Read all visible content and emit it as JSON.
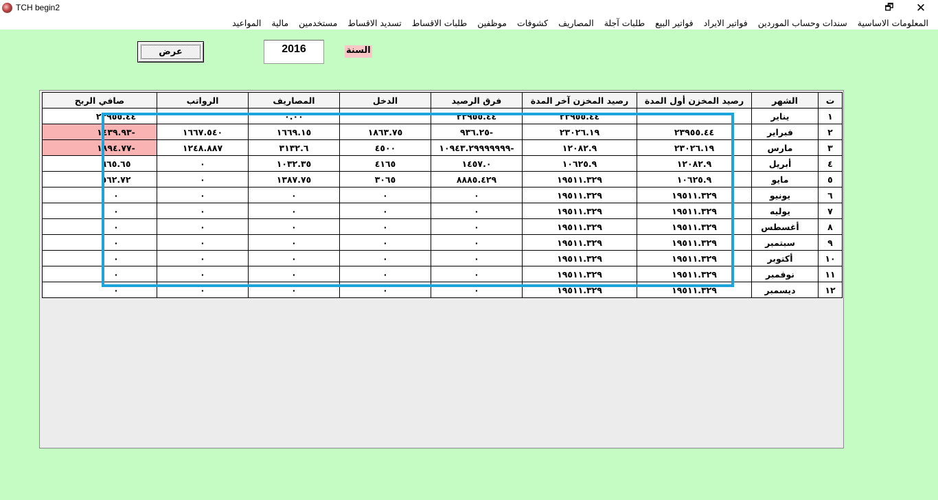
{
  "window": {
    "title": "TCH begin2",
    "restore_glyph": "🗗",
    "close_glyph": "✕"
  },
  "menu": [
    "المعلومات الاساسية",
    "سندات وحساب الموردين",
    "فواتير الايراد",
    "فواتير البيع",
    "طلبات آجلة",
    "المصاريف",
    "كشوفات",
    "موظفين",
    "طلبات الاقساط",
    "تسديد الاقساط",
    "مستخدمين",
    "مالية",
    "المواعيد"
  ],
  "form": {
    "show_button": "عرض",
    "year_value": "2016",
    "year_label": "السنة"
  },
  "table": {
    "headers": {
      "idx": "ت",
      "month": "الشهر",
      "stock_start": "رصيد المخزن أول المدة",
      "stock_end": "رصيد المخزن آخر المدة",
      "balance_diff": "فرق الرصيد",
      "income": "الدخل",
      "expenses": "المصاريف",
      "salaries": "الرواتب",
      "net_profit": "صافي الربح"
    },
    "rows": [
      {
        "idx": "١",
        "month": "يناير",
        "stock_start": "",
        "stock_end": "٢٣٩٥٥.٤٤",
        "balance_diff": "٢٣٩٥٥.٤٤",
        "income": "",
        "expenses": "٠.٠٠",
        "salaries": "",
        "net_profit": "٢٣٩٥٥.٤٤",
        "negative": false
      },
      {
        "idx": "٢",
        "month": "فبراير",
        "stock_start": "٢٣٩٥٥.٤٤",
        "stock_end": "٢٣٠٢٦.١٩",
        "balance_diff": "٩٣٦.٢٥-",
        "income": "١٨٦٣.٧٥",
        "expenses": "١٦٦٩.١٥",
        "salaries": "١٦٦٧.٥٤٠",
        "net_profit": "١٤٣٩.٩٣-",
        "negative": true
      },
      {
        "idx": "٣",
        "month": "مارس",
        "stock_start": "٢٣٠٢٦.١٩",
        "stock_end": "١٢٠٨٢.٩",
        "balance_diff": "١٠٩٤٣.٢٩٩٩٩٩٩٩-",
        "income": "٤٥٠٠",
        "expenses": "٣١٣٢.٦",
        "salaries": "١٢٤٨.٨٨٧",
        "net_profit": "١٨٩٤.٧٧-",
        "negative": true
      },
      {
        "idx": "٤",
        "month": "أبريل",
        "stock_start": "١٢٠٨٢.٩",
        "stock_end": "١٠٦٢٥.٩",
        "balance_diff": "١٤٥٧.٠",
        "income": "٤١٦٥",
        "expenses": "١٠٣٢.٣٥",
        "salaries": "٠",
        "net_profit": "٦٦٥.٦٥",
        "negative": false
      },
      {
        "idx": "٥",
        "month": "مايو",
        "stock_start": "١٠٦٢٥.٩",
        "stock_end": "١٩٥١١.٣٢٩",
        "balance_diff": "٨٨٨٥.٤٢٩",
        "income": "٣٠٦٥",
        "expenses": "١٣٨٧.٧٥",
        "salaries": "٠",
        "net_profit": "٥٦٢.٧٢",
        "negative": false
      },
      {
        "idx": "٦",
        "month": "يونيو",
        "stock_start": "١٩٥١١.٣٢٩",
        "stock_end": "١٩٥١١.٣٢٩",
        "balance_diff": "٠",
        "income": "٠",
        "expenses": "٠",
        "salaries": "٠",
        "net_profit": "٠",
        "negative": false
      },
      {
        "idx": "٧",
        "month": "يوليه",
        "stock_start": "١٩٥١١.٣٢٩",
        "stock_end": "١٩٥١١.٣٢٩",
        "balance_diff": "٠",
        "income": "٠",
        "expenses": "٠",
        "salaries": "٠",
        "net_profit": "٠",
        "negative": false
      },
      {
        "idx": "٨",
        "month": "أغسطس",
        "stock_start": "١٩٥١١.٣٢٩",
        "stock_end": "١٩٥١١.٣٢٩",
        "balance_diff": "٠",
        "income": "٠",
        "expenses": "٠",
        "salaries": "٠",
        "net_profit": "٠",
        "negative": false
      },
      {
        "idx": "٩",
        "month": "سبتمبر",
        "stock_start": "١٩٥١١.٣٢٩",
        "stock_end": "١٩٥١١.٣٢٩",
        "balance_diff": "٠",
        "income": "٠",
        "expenses": "٠",
        "salaries": "٠",
        "net_profit": "٠",
        "negative": false
      },
      {
        "idx": "١٠",
        "month": "أكتوبر",
        "stock_start": "١٩٥١١.٣٢٩",
        "stock_end": "١٩٥١١.٣٢٩",
        "balance_diff": "٠",
        "income": "٠",
        "expenses": "٠",
        "salaries": "٠",
        "net_profit": "٠",
        "negative": false
      },
      {
        "idx": "١١",
        "month": "نوفمبر",
        "stock_start": "١٩٥١١.٣٢٩",
        "stock_end": "١٩٥١١.٣٢٩",
        "balance_diff": "٠",
        "income": "٠",
        "expenses": "٠",
        "salaries": "٠",
        "net_profit": "٠",
        "negative": false
      },
      {
        "idx": "١٢",
        "month": "ديسمبر",
        "stock_start": "١٩٥١١.٣٢٩",
        "stock_end": "١٩٥١١.٣٢٩",
        "balance_diff": "٠",
        "income": "٠",
        "expenses": "٠",
        "salaries": "٠",
        "net_profit": "٠",
        "negative": false
      }
    ]
  },
  "colors": {
    "background": "#c4fcc4",
    "profit_positive": "#b6f2b6",
    "profit_negative": "#f9b3b3",
    "year_label_bg": "#f9c6c6",
    "highlight": "#1ea4dc"
  }
}
